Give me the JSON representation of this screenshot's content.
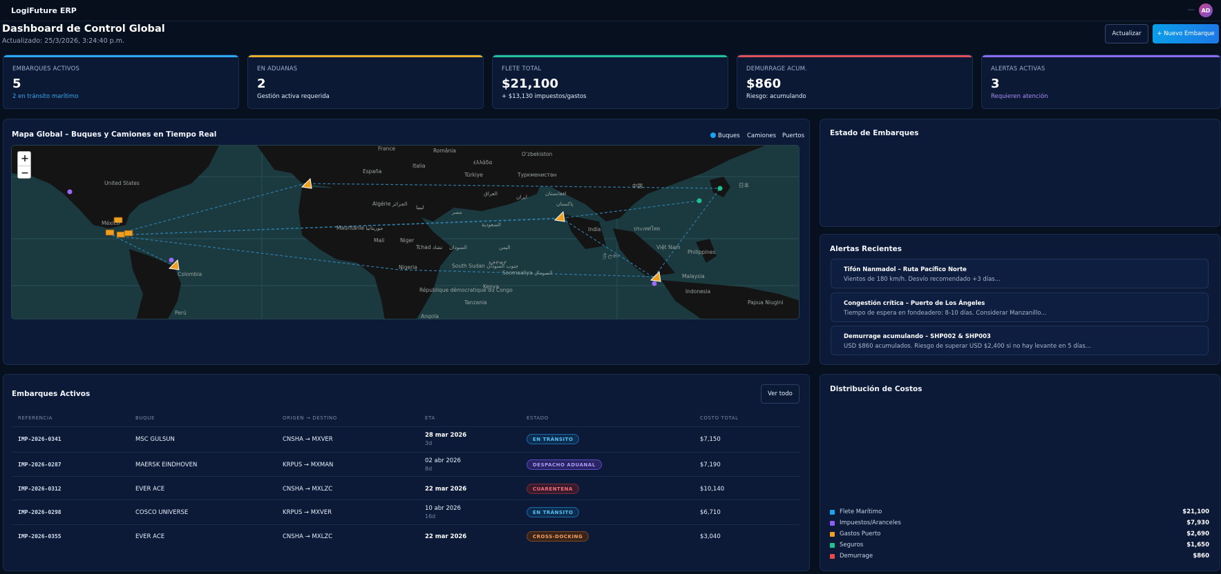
{
  "app": {
    "brand": "LogiFuture ERP",
    "top_dash": "—",
    "avatar_initials": "AD"
  },
  "header": {
    "title": "Dashboard de Control Global",
    "updated": "Actualizado: 25/3/2026, 3:24:40 p.m.",
    "refresh_label": "Actualizar",
    "new_label": "+ Nuevo Embarque"
  },
  "kpis": [
    {
      "label": "Embarques Activos",
      "value": "5",
      "sub": "2 en tránsito marítimo",
      "color": "#2aa8f0",
      "sub_color": "#35a8f0"
    },
    {
      "label": "En Aduanas",
      "value": "2",
      "sub": "Gestión activa requerida",
      "color": "#e8b02a",
      "sub_color": "#e6edf8"
    },
    {
      "label": "Flete Total",
      "value": "$21,100",
      "sub": "+ $13,130 impuestos/gastos",
      "color": "#22c39a",
      "sub_color": "#e6edf8"
    },
    {
      "label": "Demurrage Acum.",
      "value": "$860",
      "sub": "Riesgo: acumulando",
      "color": "#e0505a",
      "sub_color": "#e6edf8"
    },
    {
      "label": "Alertas Activas",
      "value": "3",
      "sub": "Requieren atención",
      "color": "#8c6af0",
      "sub_color": "#a98cf5"
    }
  ],
  "map": {
    "title": "Mapa Global – Buques y Camiones en Tiempo Real",
    "legend": {
      "ships": "Buques",
      "trucks": "Camiones",
      "ports": "Puertos"
    },
    "zoom_in": "+",
    "zoom_out": "−",
    "labels": [
      "France",
      "România",
      "ελλάδα",
      "España",
      "Italia",
      "Türkiye",
      "Oʻzbekiston",
      "Туркменистан",
      "United States",
      "Algérie الجزائر",
      "ليبيا",
      "مصر",
      "العراق",
      "ایران",
      "افغانستان",
      "پاکستان",
      "México",
      "Mauritanie موريتانيا",
      "Mali",
      "Niger",
      "Tchad تشاد",
      "السودان",
      "السعودية",
      "اليمن",
      "India",
      "Việt Nam",
      "Philippines",
      "Nigeria",
      "South Sudan جنوب السودان",
      "ኢትዮጵያ",
      "Soomaaliya الصومال",
      "Colombia",
      "République démocratique du Congo",
      "Kenya",
      "Tanzania",
      "Malaysia",
      "Indonesia",
      "Papua Niugini",
      "Perú",
      "Angola",
      "ශ්‍රී ලංකා",
      "ประเทศไทย",
      "中国",
      "日本"
    ]
  },
  "status_panel": {
    "title": "Estado de Embarques"
  },
  "alerts": {
    "title": "Alertas Recientes",
    "items": [
      {
        "title": "Tifón Nanmadol – Ruta Pacífico Norte",
        "desc": "Vientos de 180 km/h. Desvío recomendado +3 días..."
      },
      {
        "title": "Congestión crítica – Puerto de Los Ángeles",
        "desc": "Tiempo de espera en fondeadero: 8-10 días. Considerar Manzanillo..."
      },
      {
        "title": "Demurrage acumulando – SHP002 & SHP003",
        "desc": "USD $860 acumulados. Riesgo de superar USD $2,400 si no hay levante en 5 días..."
      }
    ]
  },
  "shipments": {
    "title": "Embarques Activos",
    "view_all": "Ver todo",
    "columns": [
      "Referencia",
      "Buque",
      "Origen → Destino",
      "ETA",
      "Estado",
      "Costo Total"
    ],
    "rows": [
      {
        "ref": "IMP-2026-0341",
        "vessel": "MSC GULSUN",
        "route": "CNSHA → MXVER",
        "eta": "28 mar 2026",
        "eta_sub": "3d",
        "status": "EN TRÁNSITO",
        "status_class": "b-transit",
        "cost": "$7,150"
      },
      {
        "ref": "IMP-2026-0287",
        "vessel": "MAERSK EINDHOVEN",
        "route": "KRPUS → MXMAN",
        "eta": "02 abr 2026",
        "eta_sub": "8d",
        "status": "DESPACHO ADUANAL",
        "status_class": "b-aduanal",
        "cost": "$7,190"
      },
      {
        "ref": "IMP-2026-0312",
        "vessel": "EVER ACE",
        "route": "CNSHA → MXLZC",
        "eta": "22 mar 2026",
        "eta_sub": "",
        "status": "CUARENTENA",
        "status_class": "b-cuarentena",
        "cost": "$10,140"
      },
      {
        "ref": "IMP-2026-0298",
        "vessel": "COSCO UNIVERSE",
        "route": "KRPUS → MXVER",
        "eta": "10 abr 2026",
        "eta_sub": "16d",
        "status": "EN TRÁNSITO",
        "status_class": "b-transit",
        "cost": "$6,710"
      },
      {
        "ref": "IMP-2026-0355",
        "vessel": "EVER ACE",
        "route": "CNSHA → MXLZC",
        "eta": "22 mar 2026",
        "eta_sub": "",
        "status": "CROSS-DOCKING",
        "status_class": "b-cross",
        "cost": "$3,040"
      }
    ]
  },
  "costs": {
    "title": "Distribución de Costos",
    "items": [
      {
        "name": "Flete Marítimo",
        "amount": "$21,100",
        "color": "#1aa6ef"
      },
      {
        "name": "Impuestos/Aranceles",
        "amount": "$7,930",
        "color": "#8b5cf6"
      },
      {
        "name": "Gastos Puerto",
        "amount": "$2,690",
        "color": "#f0a020"
      },
      {
        "name": "Seguros",
        "amount": "$1,650",
        "color": "#1fc28f"
      },
      {
        "name": "Demurrage",
        "amount": "$860",
        "color": "#e84a4a"
      }
    ]
  }
}
